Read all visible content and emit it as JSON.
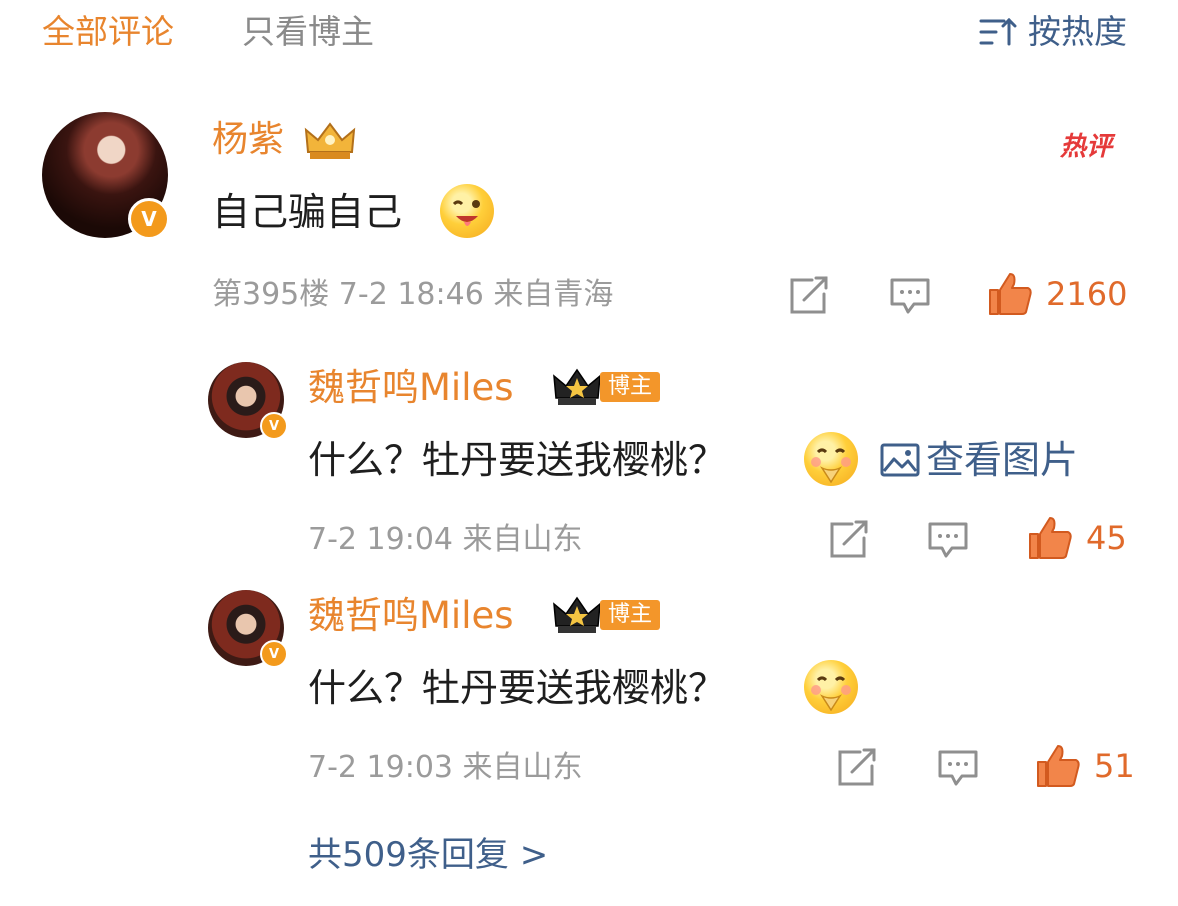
{
  "tabs": {
    "all_comments": "全部评论",
    "blogger_only": "只看博主",
    "sort_label": "按热度"
  },
  "comment": {
    "author": "杨紫",
    "verified_badge": "V",
    "hot_label": "热评",
    "text": "自己骗自己",
    "floor_time_location": "第395楼 7-2 18:46 来自青海",
    "likes": "2160"
  },
  "replies": [
    {
      "author": "魏哲鸣Miles",
      "verified_badge": "V",
      "role_badge": "博主",
      "text": "什么？牡丹要送我樱桃？",
      "image_link": "查看图片",
      "time_location": "7-2 19:04 来自山东",
      "likes": "45"
    },
    {
      "author": "魏哲鸣Miles",
      "verified_badge": "V",
      "role_badge": "博主",
      "text": "什么？牡丹要送我樱桃？",
      "time_location": "7-2 19:03 来自山东",
      "likes": "51"
    }
  ],
  "more_replies": "共509条回复 >",
  "colors": {
    "accent_orange": "#e8852e",
    "link_blue": "#3f5f8a",
    "meta_gray": "#9b9b9b",
    "hot_red": "#e53a3a"
  },
  "icons": [
    "sort-icon",
    "crown-icon",
    "share-icon",
    "reply-icon",
    "like-icon",
    "image-icon",
    "emoji-icon"
  ]
}
